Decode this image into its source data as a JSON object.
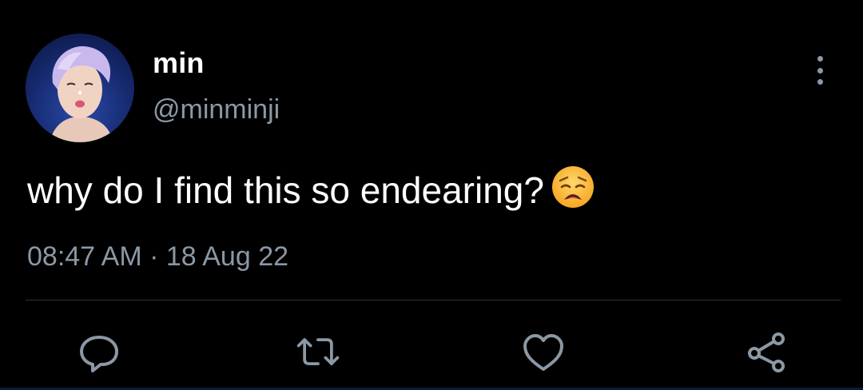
{
  "tweet": {
    "author": {
      "display_name": "min",
      "handle": "@minminji",
      "avatar_icon": "avatar"
    },
    "text": "why do I find this so endearing?",
    "emoji": "weary-face",
    "timestamp": "08:47 AM · 18 Aug 22"
  },
  "actions": {
    "reply": "reply-icon",
    "retweet": "retweet-icon",
    "like": "heart-icon",
    "share": "share-icon"
  },
  "colors": {
    "background": "#000000",
    "text": "#ffffff",
    "secondary_text": "#8b98a5",
    "divider": "#2f3336"
  }
}
